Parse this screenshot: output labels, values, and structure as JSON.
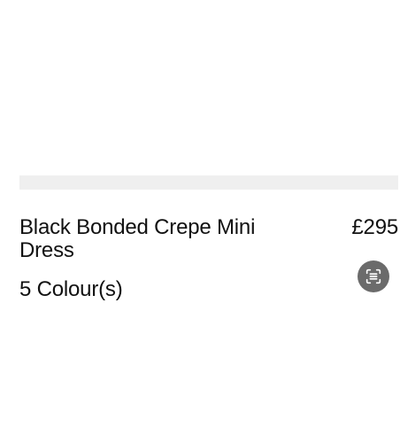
{
  "product": {
    "title": "Black Bonded Crepe Mini Dress",
    "colours": "5 Colour(s)",
    "price": "£295"
  },
  "icons": {
    "visual_search": "scan-search-icon"
  },
  "colors": {
    "image_placeholder_bar": "#efefef",
    "icon_button_bg": "#6b6b6b",
    "text": "#111111"
  }
}
